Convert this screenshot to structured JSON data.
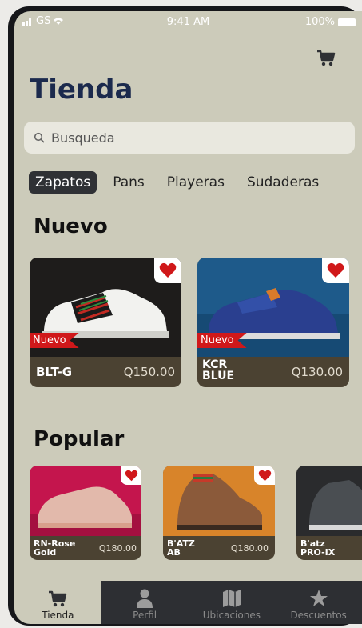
{
  "status_bar": {
    "carrier": "GS",
    "time": "9:41 AM",
    "battery": "100%"
  },
  "header": {
    "title": "Tienda",
    "cart_icon": "cart-icon"
  },
  "search": {
    "placeholder": "Busqueda"
  },
  "categories": [
    "Zapatos",
    "Pans",
    "Playeras",
    "Sudaderas"
  ],
  "active_category": "Zapatos",
  "new_section": {
    "title": "Nuevo",
    "items": [
      {
        "name": "BLT-G",
        "price": "Q150.00",
        "badge": "Nuevo"
      },
      {
        "name": "KCR BLUE",
        "price": "Q130.00",
        "badge": "Nuevo"
      }
    ]
  },
  "popular_section": {
    "title": "Popular",
    "items": [
      {
        "name": "RN-Rose Gold",
        "price": "Q180.00"
      },
      {
        "name": "B'ATZ AB",
        "price": "Q180.00"
      },
      {
        "name": "B'atz PRO-IX",
        "price": ""
      }
    ]
  },
  "tab_bar": [
    {
      "label": "Tienda",
      "icon": "cart-icon"
    },
    {
      "label": "Perfil",
      "icon": "user-icon"
    },
    {
      "label": "Ubicaciones",
      "icon": "map-icon"
    },
    {
      "label": "Descuentos",
      "icon": "star-icon"
    }
  ],
  "colors": {
    "background": "#cccbba",
    "title": "#1b2a4d",
    "card": "#4b4232",
    "badge": "#d0181a",
    "heart": "#d0181a",
    "tab_bar": "#2d2f33"
  }
}
